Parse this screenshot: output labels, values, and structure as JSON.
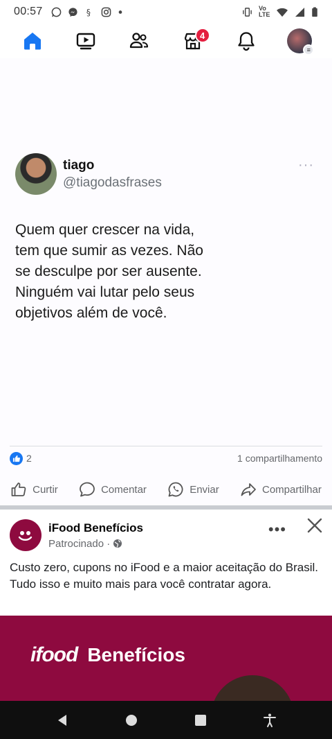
{
  "status_bar": {
    "time": "00:57",
    "network_label": "Vo LTE",
    "left_icons": [
      "whatsapp-icon",
      "messenger-icon",
      "app-icon",
      "instagram-icon",
      "dot-icon"
    ],
    "right_icons": [
      "vibrate-icon",
      "volte-icon",
      "wifi-icon",
      "signal-icon",
      "battery-icon"
    ]
  },
  "top_nav": {
    "items": [
      "home-icon",
      "video-icon",
      "friends-icon",
      "marketplace-icon",
      "notifications-icon",
      "profile-avatar"
    ],
    "marketplace_badge": "4",
    "accent_color": "#1877f2"
  },
  "post": {
    "author_name": "tiago",
    "author_handle": "@tiagodasfrases",
    "more_label": "···",
    "text": "Quem quer crescer na vida, tem que sumir as vezes. Não se desculpe por ser ausente. Ninguém vai lutar pelo seus objetivos além de você.",
    "likes_count": "2",
    "shares_label": "1 compartilhamento",
    "actions": {
      "like": "Curtir",
      "comment": "Comentar",
      "send": "Enviar",
      "share": "Compartilhar"
    }
  },
  "ad": {
    "page_name": "iFood Benefícios",
    "sponsored_label": "Patrocinado ·",
    "more_label": "•••",
    "text": "Custo zero, cupons no iFood e a maior aceitação do Brasil. Tudo isso e muito mais para você contratar agora.",
    "banner_logo": "ifood",
    "banner_title": "Benefícios",
    "brand_color": "#8e0a3f"
  },
  "system_nav": {
    "items": [
      "back-icon",
      "home-button-icon",
      "recents-icon",
      "accessibility-icon"
    ]
  }
}
